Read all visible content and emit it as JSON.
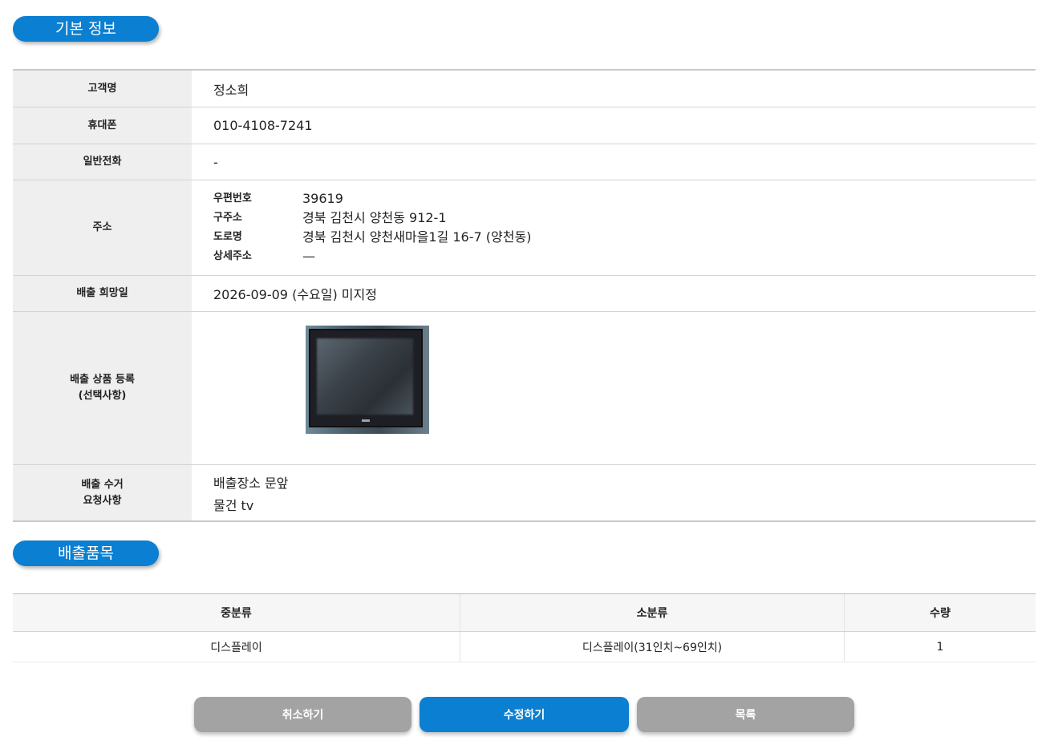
{
  "sections": {
    "basic_info": "기본 정보",
    "disposal_items": "배출품목"
  },
  "info": {
    "customer_name_label": "고객명",
    "customer_name": "정소희",
    "mobile_label": "휴대폰",
    "mobile": "010-4108-7241",
    "phone_label": "일반전화",
    "phone": "-",
    "address_label": "주소",
    "address": {
      "postal_label": "우편번호",
      "postal": "39619",
      "old_label": "구주소",
      "old": "경북 김천시 양천동 912-1",
      "road_label": "도로명",
      "road": "경북 김천시 양천새마을1길 16-7 (양천동)",
      "detail_label": "상세주소",
      "detail": "—"
    },
    "date_label": "배출 희망일",
    "date": "2026-09-09 (수요일) 미지정",
    "photo_label_line1": "배출 상품 등록",
    "photo_label_line2": "(선택사항)",
    "request_label_line1": "배출 수거",
    "request_label_line2": "요청사항",
    "request_line1": "배출장소 문앞",
    "request_line2": "물건 tv"
  },
  "items_table": {
    "headers": [
      "중분류",
      "소분류",
      "수량"
    ],
    "rows": [
      [
        "디스플레이",
        "디스플레이(31인치~69인치)",
        "1"
      ]
    ]
  },
  "buttons": {
    "cancel": "취소하기",
    "edit": "수정하기",
    "list": "목록"
  },
  "colors": {
    "accent": "#0b7fd1",
    "secondary_button": "#a3a3a3",
    "header_cell": "#efefef"
  }
}
